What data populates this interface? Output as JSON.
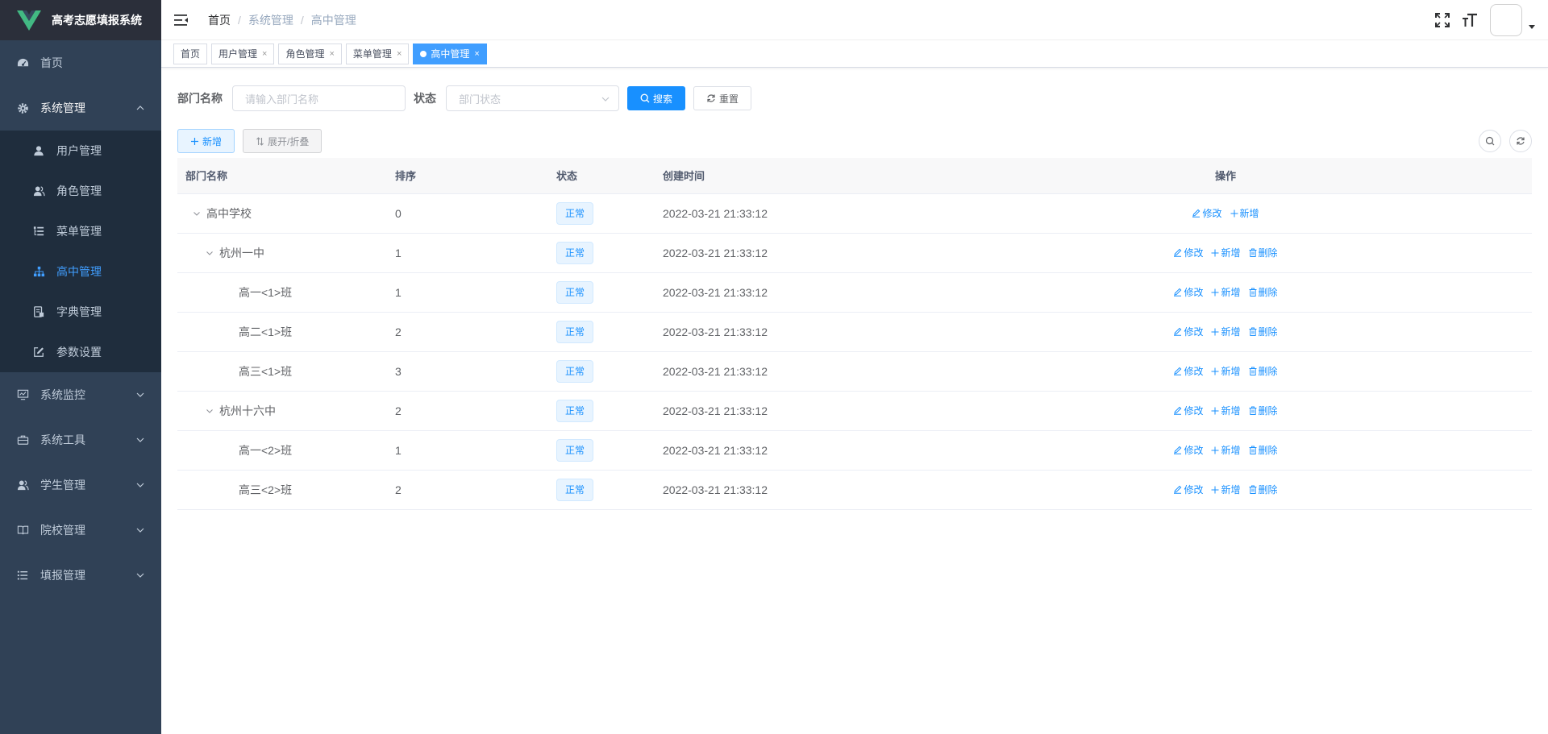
{
  "app": {
    "title": "高考志愿填报系统"
  },
  "sidebar": {
    "items": [
      {
        "label": "首页",
        "icon": "dashboard-icon"
      },
      {
        "label": "系统管理",
        "icon": "gear-icon",
        "expanded": true,
        "children": [
          {
            "label": "用户管理",
            "icon": "user-icon"
          },
          {
            "label": "角色管理",
            "icon": "peoples-icon"
          },
          {
            "label": "菜单管理",
            "icon": "tree-table-icon"
          },
          {
            "label": "高中管理",
            "icon": "tree-icon",
            "active": true
          },
          {
            "label": "字典管理",
            "icon": "dict-icon"
          },
          {
            "label": "参数设置",
            "icon": "edit-icon"
          }
        ]
      },
      {
        "label": "系统监控",
        "icon": "monitor-icon"
      },
      {
        "label": "系统工具",
        "icon": "tool-icon"
      },
      {
        "label": "学生管理",
        "icon": "peoples-icon"
      },
      {
        "label": "院校管理",
        "icon": "book-icon"
      },
      {
        "label": "填报管理",
        "icon": "list-icon"
      }
    ]
  },
  "navbar": {
    "breadcrumb": [
      "首页",
      "系统管理",
      "高中管理"
    ]
  },
  "tags": [
    {
      "label": "首页",
      "closable": false
    },
    {
      "label": "用户管理",
      "closable": true
    },
    {
      "label": "角色管理",
      "closable": true
    },
    {
      "label": "菜单管理",
      "closable": true
    },
    {
      "label": "高中管理",
      "closable": true,
      "active": true
    }
  ],
  "search": {
    "dept_label": "部门名称",
    "dept_placeholder": "请输入部门名称",
    "status_label": "状态",
    "status_placeholder": "部门状态",
    "search_btn": "搜索",
    "reset_btn": "重置"
  },
  "toolbar": {
    "add_btn": "新增",
    "expand_btn": "展开/折叠"
  },
  "table": {
    "headers": [
      "部门名称",
      "排序",
      "状态",
      "创建时间",
      "操作"
    ],
    "rows": [
      {
        "name": "高中学校",
        "level": 0,
        "expandable": true,
        "sort": "0",
        "status": "正常",
        "time": "2022-03-21 21:33:12",
        "ops": [
          "修改",
          "新增"
        ]
      },
      {
        "name": "杭州一中",
        "level": 1,
        "expandable": true,
        "sort": "1",
        "status": "正常",
        "time": "2022-03-21 21:33:12",
        "ops": [
          "修改",
          "新增",
          "删除"
        ]
      },
      {
        "name": "高一<1>班",
        "level": 2,
        "expandable": false,
        "sort": "1",
        "status": "正常",
        "time": "2022-03-21 21:33:12",
        "ops": [
          "修改",
          "新增",
          "删除"
        ]
      },
      {
        "name": "高二<1>班",
        "level": 2,
        "expandable": false,
        "sort": "2",
        "status": "正常",
        "time": "2022-03-21 21:33:12",
        "ops": [
          "修改",
          "新增",
          "删除"
        ]
      },
      {
        "name": "高三<1>班",
        "level": 2,
        "expandable": false,
        "sort": "3",
        "status": "正常",
        "time": "2022-03-21 21:33:12",
        "ops": [
          "修改",
          "新增",
          "删除"
        ]
      },
      {
        "name": "杭州十六中",
        "level": 1,
        "expandable": true,
        "sort": "2",
        "status": "正常",
        "time": "2022-03-21 21:33:12",
        "ops": [
          "修改",
          "新增",
          "删除"
        ]
      },
      {
        "name": "高一<2>班",
        "level": 2,
        "expandable": false,
        "sort": "1",
        "status": "正常",
        "time": "2022-03-21 21:33:12",
        "ops": [
          "修改",
          "新增",
          "删除"
        ]
      },
      {
        "name": "高三<2>班",
        "level": 2,
        "expandable": false,
        "sort": "2",
        "status": "正常",
        "time": "2022-03-21 21:33:12",
        "ops": [
          "修改",
          "新增",
          "删除"
        ]
      }
    ]
  },
  "colors": {
    "sidebar_bg": "#304156",
    "submenu_bg": "#1f2d3d",
    "primary": "#1890ff",
    "active_menu": "#409eff",
    "logo_green": "#42b983"
  }
}
